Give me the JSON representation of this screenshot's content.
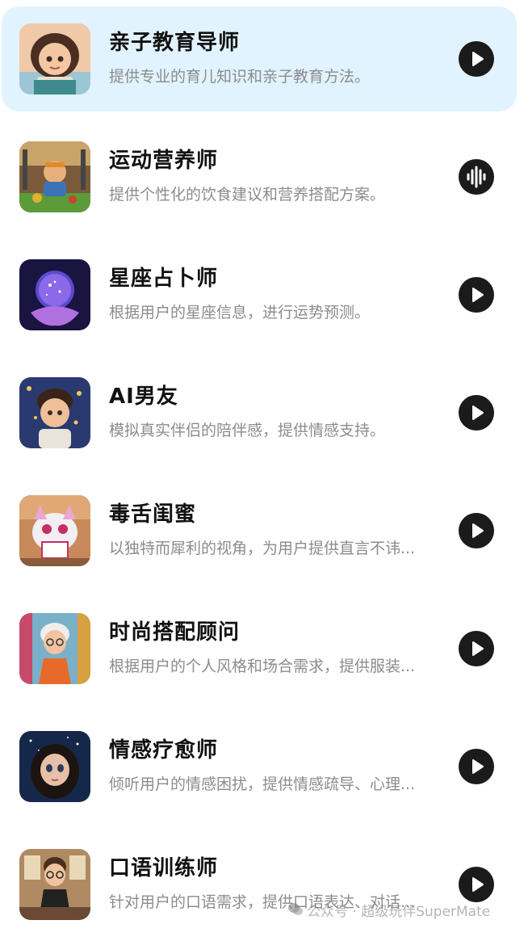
{
  "assistants": [
    {
      "title": "亲子教育导师",
      "desc": "提供专业的育儿知识和亲子教育方法。",
      "action_icon": "play-icon",
      "selected": true
    },
    {
      "title": "运动营养师",
      "desc": "提供个性化的饮食建议和营养搭配方案。",
      "action_icon": "audio-wave-icon",
      "selected": false
    },
    {
      "title": "星座占卜师",
      "desc": "根据用户的星座信息，进行运势预测。",
      "action_icon": "play-icon",
      "selected": false
    },
    {
      "title": "AI男友",
      "desc": "模拟真实伴侣的陪伴感，提供情感支持。",
      "action_icon": "play-icon",
      "selected": false
    },
    {
      "title": "毒舌闺蜜",
      "desc": "以独特而犀利的视角，为用户提供直言不讳...",
      "action_icon": "play-icon",
      "selected": false
    },
    {
      "title": "时尚搭配顾问",
      "desc": "根据用户的个人风格和场合需求，提供服装...",
      "action_icon": "play-icon",
      "selected": false
    },
    {
      "title": "情感疗愈师",
      "desc": "倾听用户的情感困扰，提供情感疏导、心理...",
      "action_icon": "play-icon",
      "selected": false
    },
    {
      "title": "口语训练师",
      "desc": "针对用户的口语需求，提供口语表达、对话...",
      "action_icon": "play-icon",
      "selected": false
    }
  ],
  "watermark": {
    "text": "公众号 · 超级玩伴SuperMate",
    "icon": "wechat-icon"
  },
  "colors": {
    "selected_bg": "#e1f3fe",
    "button_bg": "#1b1b1b",
    "title": "#111111",
    "desc": "#8c8c8c"
  }
}
